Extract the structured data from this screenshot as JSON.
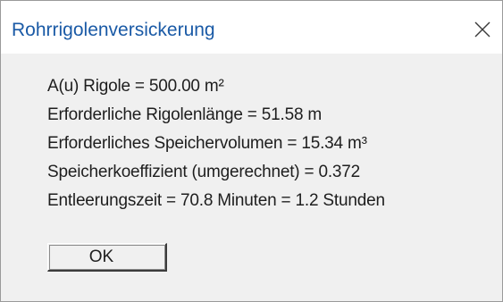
{
  "window": {
    "title": "Rohrrigolenversickerung",
    "close_icon": "close-icon",
    "accent_color": "#1a5aa6"
  },
  "message": {
    "lines": [
      "A(u) Rigole = 500.00 m²",
      "Erforderliche Rigolenlänge = 51.58 m",
      "Erforderliches Speichervolumen = 15.34 m³",
      "Speicherkoeffizient (umgerechnet) = 0.372",
      "Entleerungszeit = 70.8 Minuten = 1.2 Stunden"
    ]
  },
  "buttons": {
    "ok_label": "OK"
  }
}
